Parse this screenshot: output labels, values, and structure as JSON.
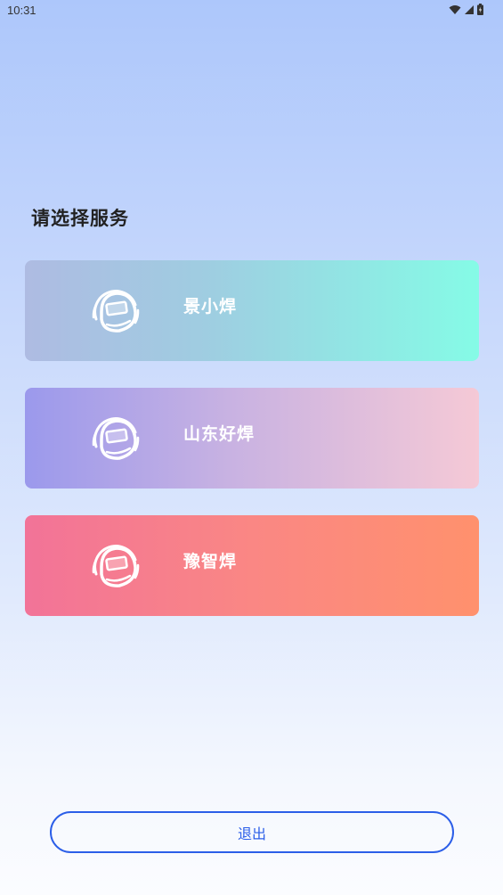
{
  "status_bar": {
    "time": "10:31",
    "icons": [
      "wifi-icon",
      "signal-icon",
      "battery-icon"
    ]
  },
  "page": {
    "title": "请选择服务"
  },
  "services": [
    {
      "label": "景小焊",
      "icon": "welding-helmet-icon"
    },
    {
      "label": "山东好焊",
      "icon": "welding-helmet-icon"
    },
    {
      "label": "豫智焊",
      "icon": "welding-helmet-icon"
    }
  ],
  "exit_button": {
    "label": "退出"
  },
  "colors": {
    "accent": "#2b5ee8",
    "card_1": [
      "#aebbe2",
      "#85fbe6"
    ],
    "card_2": [
      "#9b99ec",
      "#f5c9d6"
    ],
    "card_3": [
      "#f27398",
      "#ff916d"
    ]
  }
}
